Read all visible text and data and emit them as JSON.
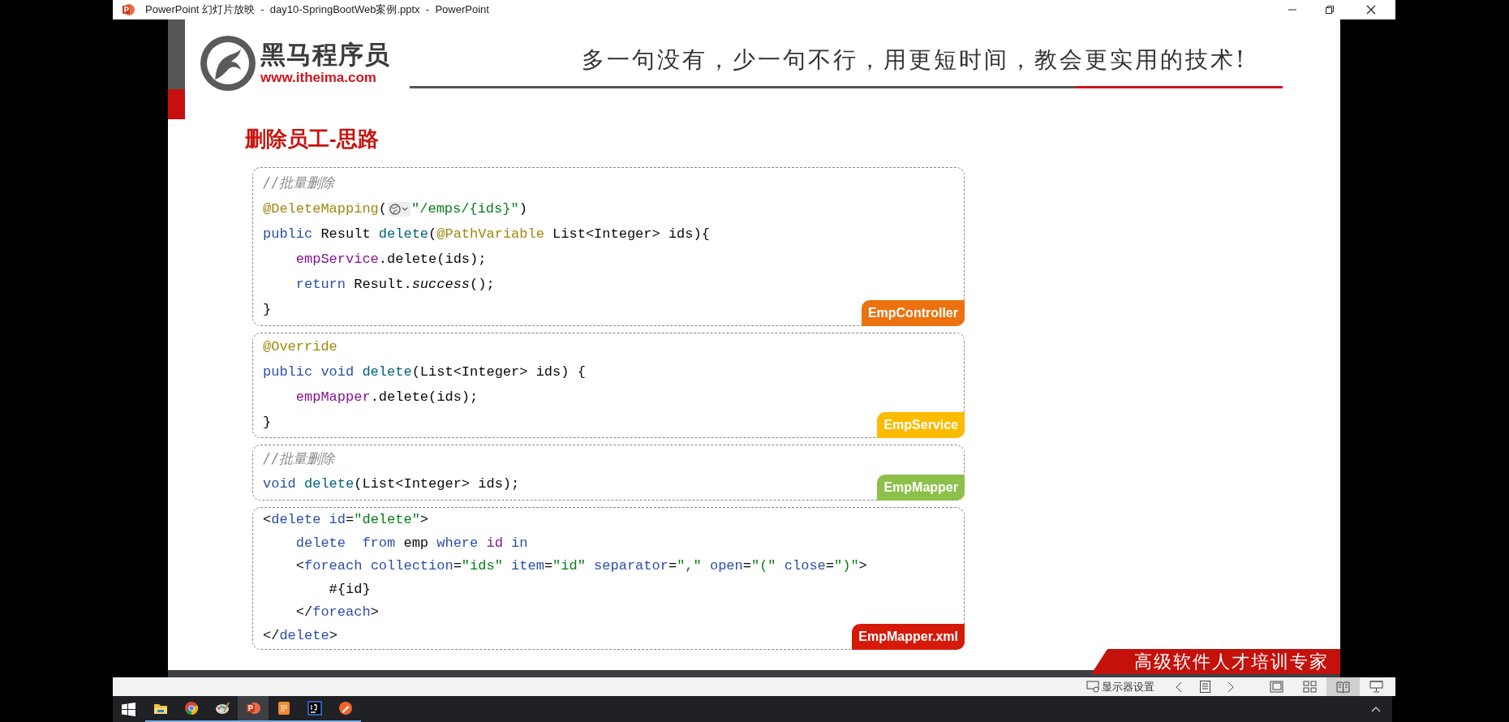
{
  "window": {
    "title": "PowerPoint 幻灯片放映  -  day10-SpringBootWeb案例.pptx  -  PowerPoint"
  },
  "slide": {
    "logo_name": "黑马程序员",
    "logo_url": "www.itheima.com",
    "slogan": "多一句没有，少一句不行，用更短时间，教会更实用的技术!",
    "title": "删除员工-思路",
    "footer": "高级软件人才培训专家",
    "code_blocks": [
      {
        "label": "EmpController",
        "color": "#ec720f",
        "lines": [
          [
            {
              "kind": "comment",
              "text": "//批量删除"
            }
          ],
          [
            {
              "kind": "annotation",
              "text": "@DeleteMapping"
            },
            {
              "kind": "plain",
              "text": "("
            },
            {
              "kind": "hint"
            },
            {
              "kind": "string",
              "text": "\"/emps/{ids}\""
            },
            {
              "kind": "plain",
              "text": ")"
            }
          ],
          [
            {
              "kind": "keyword",
              "text": "public "
            },
            {
              "kind": "plain",
              "text": "Result "
            },
            {
              "kind": "method",
              "text": "delete"
            },
            {
              "kind": "plain",
              "text": "("
            },
            {
              "kind": "annotation",
              "text": "@PathVariable"
            },
            {
              "kind": "plain",
              "text": " List<Integer> ids){"
            }
          ],
          [
            {
              "kind": "field",
              "text": "    empService"
            },
            {
              "kind": "plain",
              "text": ".delete(ids);"
            }
          ],
          [
            {
              "kind": "keyword",
              "text": "    return "
            },
            {
              "kind": "plain",
              "text": "Result."
            },
            {
              "kind": "italic",
              "text": "success"
            },
            {
              "kind": "plain",
              "text": "();"
            }
          ],
          [
            {
              "kind": "plain",
              "text": "}"
            }
          ]
        ]
      },
      {
        "label": "EmpService",
        "color": "#fbbb00",
        "lines": [
          [
            {
              "kind": "annotation",
              "text": "@Override"
            }
          ],
          [
            {
              "kind": "keyword",
              "text": "public void "
            },
            {
              "kind": "method",
              "text": "delete"
            },
            {
              "kind": "plain",
              "text": "(List<Integer> ids) {"
            }
          ],
          [
            {
              "kind": "field",
              "text": "    empMapper"
            },
            {
              "kind": "plain",
              "text": ".delete(ids);"
            }
          ],
          [
            {
              "kind": "plain",
              "text": "}"
            }
          ]
        ]
      },
      {
        "label": "EmpMapper",
        "color": "#8cc04a",
        "lines": [
          [
            {
              "kind": "comment",
              "text": "//批量删除"
            }
          ],
          [
            {
              "kind": "keyword",
              "text": "void "
            },
            {
              "kind": "method",
              "text": "delete"
            },
            {
              "kind": "plain",
              "text": "(List<Integer> ids);"
            }
          ]
        ]
      },
      {
        "label": "EmpMapper.xml",
        "color": "#d61a0a",
        "lines": [
          [
            {
              "kind": "plain",
              "text": "<"
            },
            {
              "kind": "keyword",
              "text": "delete id"
            },
            {
              "kind": "plain",
              "text": "="
            },
            {
              "kind": "string",
              "text": "\"delete\""
            },
            {
              "kind": "plain",
              "text": ">"
            }
          ],
          [
            {
              "kind": "keyword",
              "text": "    delete  from "
            },
            {
              "kind": "plain",
              "text": "emp "
            },
            {
              "kind": "keyword",
              "text": "where "
            },
            {
              "kind": "field",
              "text": "id "
            },
            {
              "kind": "keyword",
              "text": "in"
            }
          ],
          [
            {
              "kind": "plain",
              "text": "    <"
            },
            {
              "kind": "keyword",
              "text": "foreach collection"
            },
            {
              "kind": "plain",
              "text": "="
            },
            {
              "kind": "string",
              "text": "\"ids\" "
            },
            {
              "kind": "keyword",
              "text": "item"
            },
            {
              "kind": "plain",
              "text": "="
            },
            {
              "kind": "string",
              "text": "\"id\" "
            },
            {
              "kind": "keyword",
              "text": "separator"
            },
            {
              "kind": "plain",
              "text": "="
            },
            {
              "kind": "string",
              "text": "\",\" "
            },
            {
              "kind": "keyword",
              "text": "open"
            },
            {
              "kind": "plain",
              "text": "="
            },
            {
              "kind": "string",
              "text": "\"(\" "
            },
            {
              "kind": "keyword",
              "text": "close"
            },
            {
              "kind": "plain",
              "text": "="
            },
            {
              "kind": "string",
              "text": "\")\""
            },
            {
              "kind": "plain",
              "text": ">"
            }
          ],
          [
            {
              "kind": "plain",
              "text": "        #{id}"
            }
          ],
          [
            {
              "kind": "plain",
              "text": "    </"
            },
            {
              "kind": "keyword",
              "text": "foreach"
            },
            {
              "kind": "plain",
              "text": ">"
            }
          ],
          [
            {
              "kind": "plain",
              "text": "</"
            },
            {
              "kind": "keyword",
              "text": "delete"
            },
            {
              "kind": "plain",
              "text": ">"
            }
          ]
        ]
      }
    ]
  },
  "status_bar": {
    "display_settings": "显示器设置",
    "views": [
      {
        "kind": "normal",
        "selected": false
      },
      {
        "kind": "sorter",
        "selected": false
      },
      {
        "kind": "reading",
        "selected": true
      },
      {
        "kind": "slideshow",
        "selected": false
      }
    ]
  },
  "taskbar": {
    "apps": [
      {
        "kind": "explorer",
        "selected": false
      },
      {
        "kind": "chrome",
        "selected": false
      },
      {
        "kind": "paint",
        "selected": false
      },
      {
        "kind": "powerpoint",
        "selected": true
      },
      {
        "kind": "pdf",
        "selected": false
      },
      {
        "kind": "intellij",
        "selected": false
      },
      {
        "kind": "pen",
        "selected": false
      }
    ]
  }
}
